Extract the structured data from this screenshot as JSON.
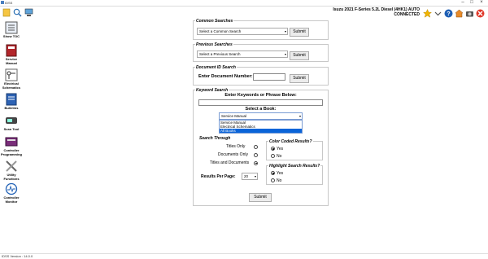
{
  "window": {
    "title": "IDSS"
  },
  "toolbar": {
    "vehicle_line1": "Isuzu 2021 F-Series 5.2L Diesel (4HK1) AUTO",
    "vehicle_line2": "CONNECTED",
    "icons": [
      "star-icon",
      "help-icon",
      "home-icon",
      "camera-icon",
      "close-icon"
    ]
  },
  "sidebar": {
    "items": [
      {
        "label": "Show TOC"
      },
      {
        "label": "Service Manual"
      },
      {
        "label": "Electrical Schematics"
      },
      {
        "label": "Bulletins"
      },
      {
        "label": "Scan Tool"
      },
      {
        "label": "Controller Programming"
      },
      {
        "label": "Utility Functions"
      },
      {
        "label": "Controller Monitor"
      }
    ]
  },
  "common_searches": {
    "legend": "Common Searches",
    "placeholder": "Select a Common Search",
    "submit": "Submit"
  },
  "previous_searches": {
    "legend": "Previous Searches",
    "placeholder": "Select a Previous Search",
    "submit": "Submit"
  },
  "document_id": {
    "legend": "Document ID Search",
    "label": "Enter Document Number:",
    "value": "",
    "submit": "Submit"
  },
  "keyword_search": {
    "legend": "Keyword Search",
    "prompt": "Enter Keywords or Phrase Below:",
    "value": "",
    "book_label": "Select a Book:",
    "book_selected": "Service Manual",
    "book_options": [
      "Service Manual",
      "Electrical Schematics",
      "All Books"
    ],
    "book_highlighted": 2,
    "search_through": {
      "legend": "Search Through",
      "options": [
        {
          "label": "Titles Only",
          "checked": false
        },
        {
          "label": "Documents Only",
          "checked": false
        },
        {
          "label": "Titles and Documents",
          "checked": true
        }
      ]
    },
    "results_per_page": {
      "label": "Results Per Page:",
      "value": "20"
    },
    "color_coded": {
      "legend": "Color Coded Results?",
      "yes": "Yes",
      "no": "No",
      "selected": "Yes"
    },
    "highlight": {
      "legend": "Highlight Search Results?",
      "yes": "Yes",
      "no": "No",
      "selected": "Yes"
    },
    "submit": "Submit"
  },
  "status_bar": {
    "text": "IDSS Version : 14.0.0"
  },
  "colors": {
    "selection": "#0a64d8",
    "border": "#c8c8c8"
  }
}
